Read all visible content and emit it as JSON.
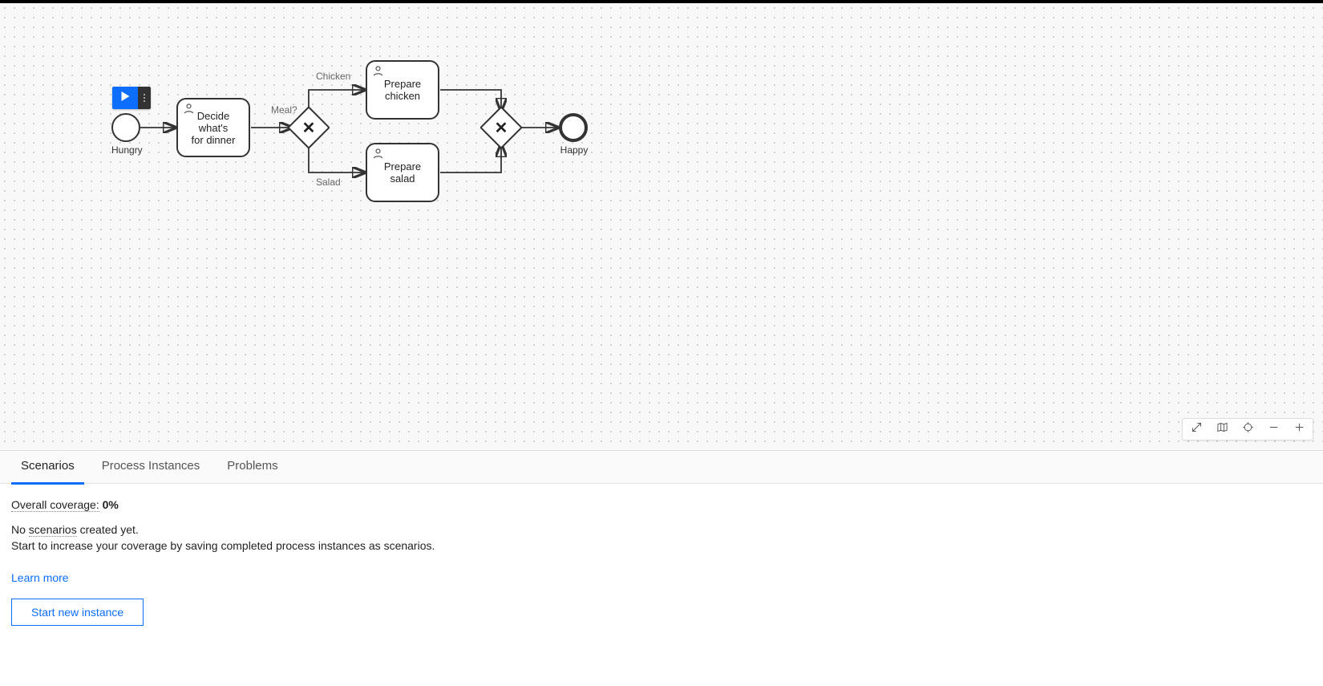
{
  "diagram": {
    "startEvent": {
      "label": "Hungry"
    },
    "endEvent": {
      "label": "Happy"
    },
    "tasks": {
      "decide": "Decide what's\nfor dinner",
      "prepareChicken": "Prepare\nchicken",
      "prepareSalad": "Prepare salad"
    },
    "gateways": {
      "split": {
        "label": "Meal?"
      }
    },
    "edges": {
      "chicken": "Chicken",
      "salad": "Salad"
    }
  },
  "tabs": {
    "scenarios": "Scenarios",
    "processInstances": "Process Instances",
    "problems": "Problems"
  },
  "panel": {
    "coverageLabel": "Overall coverage:",
    "coverageValue": "0%",
    "emptyMsg1_a": "No ",
    "emptyMsg1_b": "scenarios",
    "emptyMsg1_c": " created yet.",
    "emptyMsg2": "Start to increase your coverage by saving completed process instances as scenarios.",
    "learnMore": "Learn more",
    "startButton": "Start new instance"
  },
  "canvasToolbar": {
    "expand": "expand",
    "map": "minimap",
    "reset": "reset-view",
    "zoomOut": "zoom-out",
    "zoomIn": "zoom-in"
  }
}
